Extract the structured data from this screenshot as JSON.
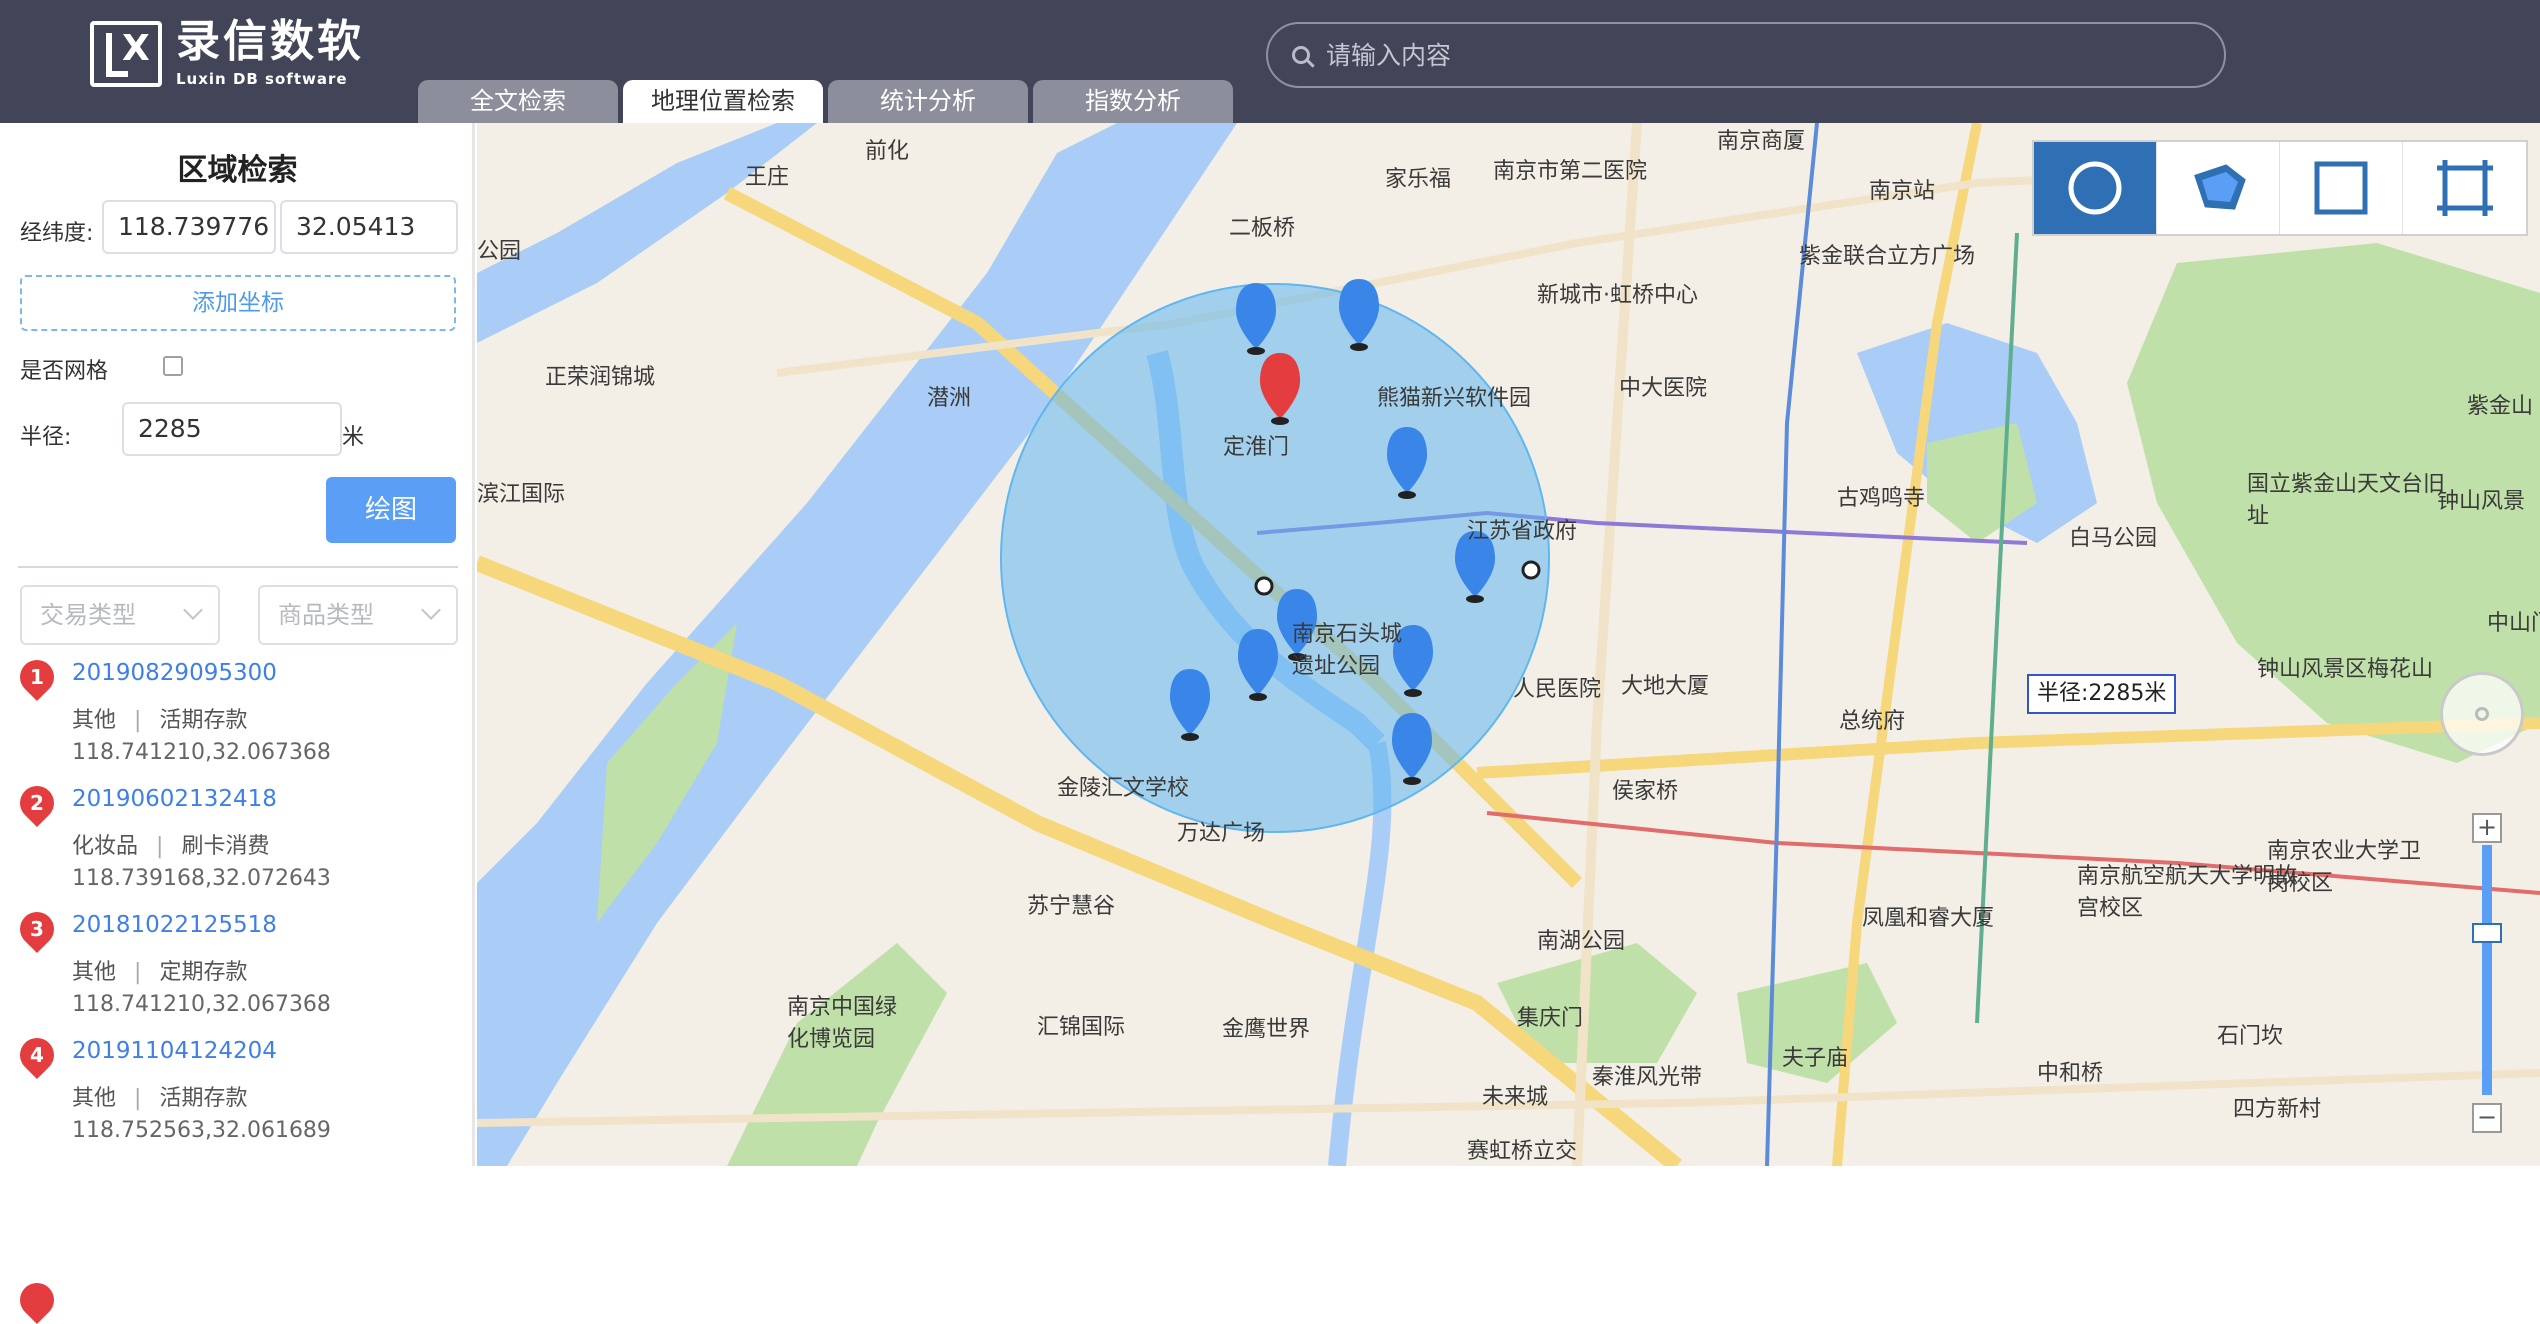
{
  "header": {
    "logo_cn": "录信数软",
    "logo_en": "Luxin DB software",
    "search_placeholder": "请输入内容",
    "tabs": [
      {
        "label": "全文检索"
      },
      {
        "label": "地理位置检索"
      },
      {
        "label": "统计分析"
      },
      {
        "label": "指数分析"
      }
    ],
    "active_tab": "地理位置检索"
  },
  "sidebar": {
    "title": "区域检索",
    "coord_label": "经纬度:",
    "longitude": "118.739776",
    "latitude": "32.05413",
    "add_button": "添加坐标",
    "grid_label": "是否网格",
    "grid_checked": false,
    "radius_label": "半径:",
    "radius_value": "2285",
    "radius_unit": "米",
    "draw_button": "绘图",
    "filters": [
      {
        "placeholder": "交易类型"
      },
      {
        "placeholder": "商品类型"
      }
    ],
    "records": [
      {
        "index": "1",
        "id": "20190829095300",
        "category": "其他",
        "type": "活期存款",
        "coord": "118.741210,32.067368"
      },
      {
        "index": "2",
        "id": "20190602132418",
        "category": "化妆品",
        "type": "刷卡消费",
        "coord": "118.739168,32.072643"
      },
      {
        "index": "3",
        "id": "20181022125518",
        "category": "其他",
        "type": "定期存款",
        "coord": "118.741210,32.067368"
      },
      {
        "index": "4",
        "id": "20191104124204",
        "category": "其他",
        "type": "活期存款",
        "coord": "118.752563,32.061689"
      }
    ]
  },
  "map": {
    "radius_tag": "半径:2285米",
    "colors": {
      "circle": "#5fb6f0",
      "marker": "#3a86e8",
      "marker_selected": "#e43d3f",
      "river": "#a9cdf7",
      "park": "#bfe0a8"
    },
    "tools": [
      {
        "name": "circle-tool-icon"
      },
      {
        "name": "polygon-tool-icon"
      },
      {
        "name": "rectangle-tool-icon"
      },
      {
        "name": "crop-tool-icon"
      }
    ],
    "labels": [
      {
        "text": "南京商厦"
      },
      {
        "text": "南京市第二医院"
      },
      {
        "text": "家乐福"
      },
      {
        "text": "南京站"
      },
      {
        "text": "紫金联合立方广场"
      },
      {
        "text": "新城市·虹桥中心"
      },
      {
        "text": "二板桥"
      },
      {
        "text": "熊猫新兴软件园"
      },
      {
        "text": "中大医院"
      },
      {
        "text": "正荣润锦城"
      },
      {
        "text": "潜洲"
      },
      {
        "text": "定淮门"
      },
      {
        "text": "古鸡鸣寺"
      },
      {
        "text": "紫金山"
      },
      {
        "text": "江苏省政府"
      },
      {
        "text": "滨江国际"
      },
      {
        "text": "国立紫金山天文台旧址"
      },
      {
        "text": "白马公园"
      },
      {
        "text": "钟山风景"
      },
      {
        "text": "南京石头城遗址公园"
      },
      {
        "text": "人民医院"
      },
      {
        "text": "大地大厦"
      },
      {
        "text": "总统府"
      },
      {
        "text": "钟山风景区梅花山"
      },
      {
        "text": "金陵汇文学校"
      },
      {
        "text": "侯家桥"
      },
      {
        "text": "万达广场"
      },
      {
        "text": "苏宁慧谷"
      },
      {
        "text": "南京航空航天大学明故宫校区"
      },
      {
        "text": "南京农业大学卫岗校区"
      },
      {
        "text": "凤凰和睿大厦"
      },
      {
        "text": "南湖公园"
      },
      {
        "text": "南京中国绿化博览园"
      },
      {
        "text": "汇锦国际"
      },
      {
        "text": "金鹰世界"
      },
      {
        "text": "集庆门"
      },
      {
        "text": "夫子庙"
      },
      {
        "text": "石门坎"
      },
      {
        "text": "中和桥"
      },
      {
        "text": "四方新村"
      },
      {
        "text": "未来城"
      },
      {
        "text": "秦淮风光带"
      },
      {
        "text": "赛虹桥立交"
      },
      {
        "text": "中山门"
      },
      {
        "text": "王庄"
      },
      {
        "text": "前化"
      },
      {
        "text": "公园"
      }
    ]
  }
}
